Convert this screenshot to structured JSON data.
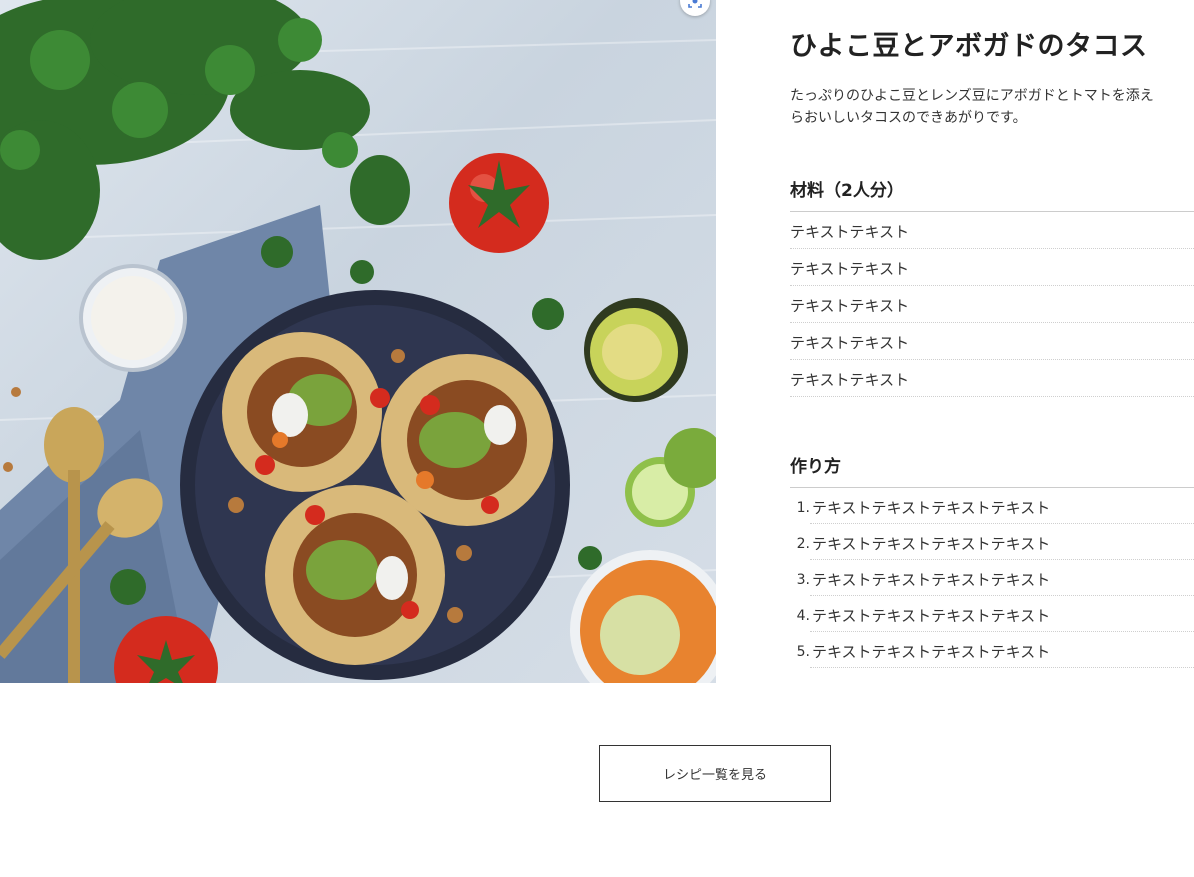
{
  "recipe": {
    "title": "ひよこ豆とアボガドのタコス",
    "description": "たっぷりのひよこ豆とレンズ豆にアボガドとトマトを添え\nらおいしいタコスのできあがりです。"
  },
  "photo": {
    "alt": "ひよこ豆とアボガドのタコス",
    "lens_icon": "lens-icon"
  },
  "ingredients": {
    "heading": "材料（2人分）",
    "items": [
      "テキストテキスト",
      "テキストテキスト",
      "テキストテキスト",
      "テキストテキスト",
      "テキストテキスト"
    ]
  },
  "steps": {
    "heading": "作り方",
    "items": [
      {
        "num": "1.",
        "text": "テキストテキストテキストテキスト"
      },
      {
        "num": "2.",
        "text": "テキストテキストテキストテキスト"
      },
      {
        "num": "3.",
        "text": "テキストテキストテキストテキスト"
      },
      {
        "num": "4.",
        "text": "テキストテキストテキストテキスト"
      },
      {
        "num": "5.",
        "text": "テキストテキストテキストテキスト"
      }
    ]
  },
  "footer": {
    "list_button_label": "レシピ一覧を見る"
  },
  "colors": {
    "text": "#222222",
    "rule": "#cccccc",
    "plate": "#2c3348",
    "tortilla": "#d9b97a",
    "avocado": "#6f9a3a",
    "tomato": "#d42b1e"
  }
}
